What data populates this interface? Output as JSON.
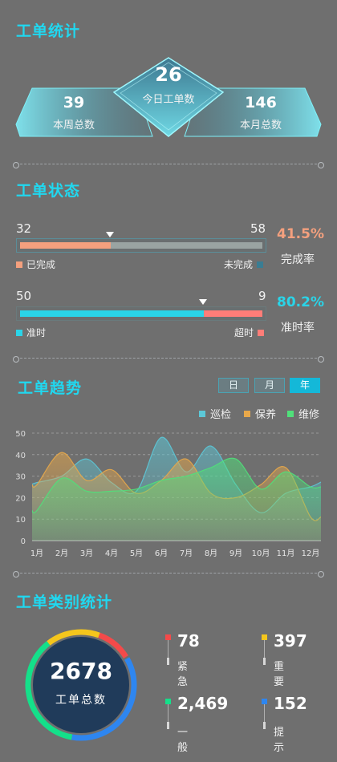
{
  "summary": {
    "title": "工单统计",
    "today": {
      "value": "26",
      "label": "今日工单数"
    },
    "week": {
      "value": "39",
      "label": "本周总数"
    },
    "month": {
      "value": "146",
      "label": "本月总数"
    }
  },
  "status": {
    "title": "工单状态",
    "completion": {
      "left_value": "32",
      "right_value": "58",
      "left_label": "已完成",
      "right_label": "未完成",
      "rate": "41.5%",
      "rate_label": "完成率",
      "fraction": 0.375,
      "left_color": "#f4a07e",
      "right_color": "#9aa4a2",
      "rate_color": "#f4a07e",
      "right_sq_color": "#3a7d93"
    },
    "ontime": {
      "left_value": "50",
      "right_value": "9",
      "left_label": "准时",
      "right_label": "超时",
      "rate": "80.2%",
      "rate_label": "准时率",
      "fraction": 0.758,
      "left_color": "#2ad4e8",
      "right_color": "#ff7d78",
      "rate_color": "#2ad4e8",
      "right_sq_color": "#ff7d78"
    }
  },
  "trend": {
    "title": "工单趋势",
    "tabs": [
      "日",
      "月",
      "年"
    ],
    "active_tab": 2
  },
  "chart_data": {
    "type": "area",
    "categories": [
      "1月",
      "2月",
      "3月",
      "4月",
      "5月",
      "6月",
      "7月",
      "8月",
      "9月",
      "10月",
      "11月",
      "12月"
    ],
    "ylim": [
      0,
      50
    ],
    "yticks": [
      0,
      10,
      20,
      30,
      40,
      50
    ],
    "grid": true,
    "legend_position": "top-right",
    "series": [
      {
        "name": "巡检",
        "color": "#5cc8d8",
        "values": [
          27,
          30,
          38,
          27,
          23,
          48,
          32,
          44,
          26,
          13,
          22,
          25
        ]
      },
      {
        "name": "保养",
        "color": "#e8a84a",
        "values": [
          26,
          41,
          28,
          33,
          22,
          28,
          38,
          22,
          20,
          26,
          34,
          11
        ]
      },
      {
        "name": "维修",
        "color": "#50e07a",
        "values": [
          14,
          29,
          23,
          23,
          24,
          28,
          30,
          34,
          38,
          24,
          32,
          25
        ]
      }
    ]
  },
  "category": {
    "title": "工单类别统计",
    "total": "2678",
    "total_label": "工单总数",
    "items": [
      {
        "value": "78",
        "label": "紧急",
        "color": "#f44a4a"
      },
      {
        "value": "397",
        "label": "重要",
        "color": "#f5c61c"
      },
      {
        "value": "2,469",
        "label": "一般",
        "color": "#14e08a"
      },
      {
        "value": "152",
        "label": "提示",
        "color": "#2e86f0"
      }
    ]
  }
}
